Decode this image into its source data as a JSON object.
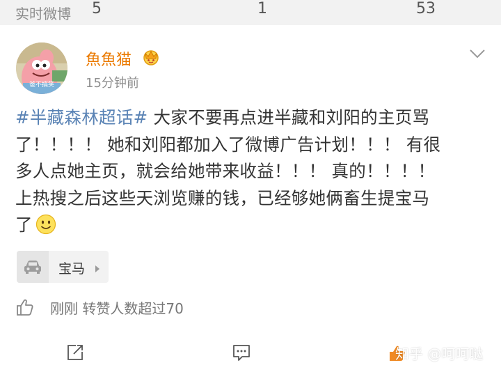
{
  "header": {
    "title": "实时微博"
  },
  "post": {
    "avatar_label": "爸不搞笑",
    "username": "魚魚猫",
    "timestamp": "15分钟前",
    "topic": "#半藏森林超话#",
    "lines": [
      " 大家不要再点进半藏和刘阳的主页骂",
      "了！！！！ 她和刘阳都加入了微博广告计划！！！ 有很",
      "多人点她主页，就会给她带来收益！！！ 真的！！！！",
      "上热搜之后这些天浏览赚的钱，已经够她俩畜生提宝马",
      "了"
    ]
  },
  "tag": {
    "label": "宝马"
  },
  "likes_summary": "刚刚 转赞人数超过70",
  "actions": {
    "share_count": "5",
    "comment_count": "1",
    "like_count": "53"
  },
  "watermark": "知乎 @呵呵哒",
  "colors": {
    "topic": "#5a83b5",
    "username": "#eb7a00",
    "header_bg": "#f2f2f2"
  },
  "icons": [
    "vip-crown-icon",
    "chevron-down-icon",
    "smile-emoji-icon",
    "car-icon",
    "arrow-right-icon",
    "thumbs-up-icon",
    "share-icon",
    "comment-icon",
    "like-icon"
  ]
}
